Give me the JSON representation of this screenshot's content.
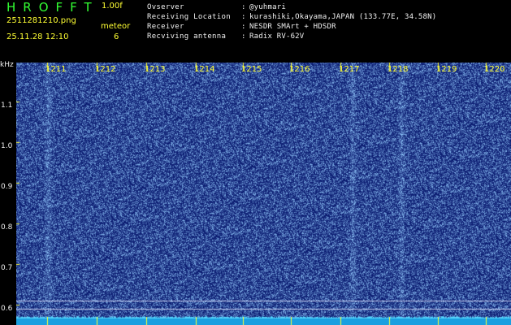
{
  "header": {
    "app_title": "HROFFT",
    "version": "1.00f",
    "filename": "2511281210.png",
    "mode": "meteor",
    "timestamp": "25.11.28 12:10",
    "count": "6",
    "info": [
      {
        "label": "Ovserver",
        "value": "@yuhmari"
      },
      {
        "label": "Receiving Location",
        "value": "kurashiki,Okayama,JAPAN (133.77E, 34.58N)"
      },
      {
        "label": "Receiver",
        "value": "NESDR SMArt + HDSDR"
      },
      {
        "label": "Recviving antenna",
        "value": "Radix RV-62V"
      }
    ]
  },
  "colors": {
    "label_yellow": "#ffff33",
    "label_green": "#33ff33",
    "noise_background": "#0a1a78",
    "noise_bright": "#7fb4ff",
    "baseline_cyan": "#33ccff"
  },
  "chart_data": {
    "type": "heatmap",
    "ylabel": "kHz",
    "yticks": [
      "1.1",
      "1.0",
      "0.9",
      "0.8",
      "0.7",
      "0.6"
    ],
    "xticks": [
      "1211",
      "1212",
      "1213",
      "1214",
      "1215",
      "1216",
      "1217",
      "1218",
      "1219",
      "1220"
    ],
    "bright_columns": [
      "1211",
      "1217",
      "1218"
    ],
    "horizontal_lines_khz": [
      0.625,
      0.605
    ]
  }
}
